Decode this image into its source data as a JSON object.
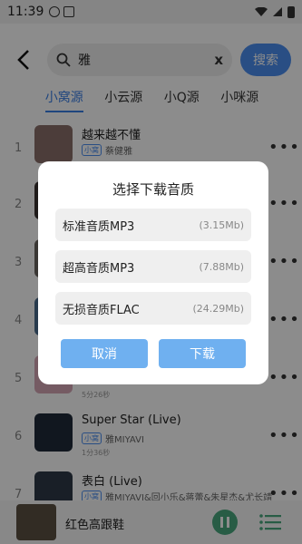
{
  "status_bar": {
    "time": "11:39"
  },
  "search": {
    "query": "雅",
    "clear_label": "x",
    "button_label": "搜索"
  },
  "tabs": [
    {
      "label": "小窝源"
    },
    {
      "label": "小云源"
    },
    {
      "label": "小Q源"
    },
    {
      "label": "小咪源"
    }
  ],
  "songs": [
    {
      "index": "1",
      "title": "越来越不懂",
      "badge": "小窝",
      "artist": "蔡健雅",
      "duration": ""
    },
    {
      "index": "2",
      "title": "",
      "badge": "",
      "artist": "",
      "duration": ""
    },
    {
      "index": "3",
      "title": "",
      "badge": "",
      "artist": "",
      "duration": ""
    },
    {
      "index": "4",
      "title": "",
      "badge": "",
      "artist": "",
      "duration": ""
    },
    {
      "index": "5",
      "title": "",
      "badge": "",
      "artist": "",
      "duration": "5分26秒"
    },
    {
      "index": "6",
      "title": "Super Star (Live)",
      "badge": "小窝",
      "artist": "雅MIYAVI",
      "duration": "1分36秒"
    },
    {
      "index": "7",
      "title": "表白 (Live)",
      "badge": "小窝",
      "artist": "雅MIYAVI&回小乐&蒋蕾&朱星杰&尤长靖",
      "duration": ""
    }
  ],
  "more_label": "•••",
  "player": {
    "title": "红色高跟鞋"
  },
  "dialog": {
    "title": "选择下载音质",
    "options": [
      {
        "label": "标准音质MP3",
        "size": "(3.15Mb)"
      },
      {
        "label": "超高音质MP3",
        "size": "(7.88Mb)"
      },
      {
        "label": "无损音质FLAC",
        "size": "(24.29Mb)"
      }
    ],
    "cancel_label": "取消",
    "confirm_label": "下载"
  },
  "colors": {
    "accent": "#4b8ef0",
    "dialog_button": "#6fb0f0",
    "play_button": "#49a87f"
  }
}
